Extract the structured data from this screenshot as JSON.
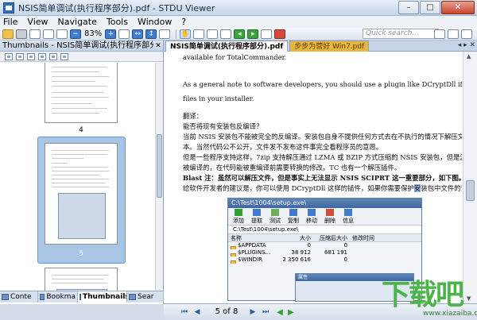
{
  "window": {
    "title": "NSIS简单调试(执行程序部分).pdf - STDU Viewer",
    "controls": {
      "minimize": "–",
      "maximize": "□",
      "close": "✕"
    }
  },
  "menu": {
    "items": [
      "File",
      "View",
      "Navigate",
      "Tools",
      "Window",
      "?"
    ]
  },
  "toolbar": {
    "zoom": "83%",
    "quick_search_placeholder": "Quick search..."
  },
  "left_panel": {
    "header": "Thumbnails - NSIS简单调试(执行程序部分).pdf",
    "thumb_labels": [
      "4",
      "5"
    ],
    "bottom_tabs": [
      "Conte",
      "Bookma",
      "Thumbnails",
      "Sear"
    ]
  },
  "doc_tabs": {
    "tabs": [
      "NSIS简单调试(执行程序部分).pdf",
      "步步为营好 Win7.pdf"
    ]
  },
  "page_text": {
    "l0": "available for TotalCommander.",
    "l1": "As a general note to software developers, you should use a plugin like DCryptDll if you need to protect certain",
    "l2": "files in your installer.",
    "l3": "翻译：",
    "l4": "能否将现有安装包反编译？",
    "l5": "当前 NSIS 安装包不能被完全的反编译。安装包自身不提供任何方式去在不执行的情况下解压文件或解",
    "l6": "本。当然代码公不公开，文件发不发布这件事完全看程序员的意愿。",
    "l7": "但是一些程序支持这样，7zip 支持解压通过 LZMA 或 BZIP 方式压缩的 NSIS 安装包，但是源代码还是",
    "l8": "被编译的，在代码能被重编译前需要转换的修改。TC 也有一个解压插件。",
    "l9": "Blast 注：虽然可以解压文件，但是事实上无法显示 NSIS SCIPRT 这一重要部分，如下图。",
    "l10a": "给软件开发者的建议是，你可以使用 DCryptDll 这样的插件，如果你需要保护",
    "l10b": "安",
    "l10c": "装包中文件的话。"
  },
  "embedded_shot": {
    "title": "C:\\Test\\1004\\setup.exe\\",
    "tools": [
      "添加",
      "提取",
      "测试",
      "复制",
      "移动",
      "删除",
      "信息"
    ],
    "path": "C:\\Test\\1004\\setup.exe\\",
    "columns": [
      "名称",
      "大小",
      "压缩后大小",
      "修改时间"
    ],
    "rows": [
      {
        "name": "$APPDATA",
        "size": "0",
        "packed": "0"
      },
      {
        "name": "$PLUGINS...",
        "size": "38 912",
        "packed": "681 191"
      },
      {
        "name": "$WINDIR",
        "size": "2 350 616",
        "packed": "0"
      }
    ],
    "inner_title": "属性"
  },
  "status": {
    "page": "5 of 8"
  },
  "watermark": {
    "text": "下载吧",
    "url": "www.xiazaiba.com"
  }
}
